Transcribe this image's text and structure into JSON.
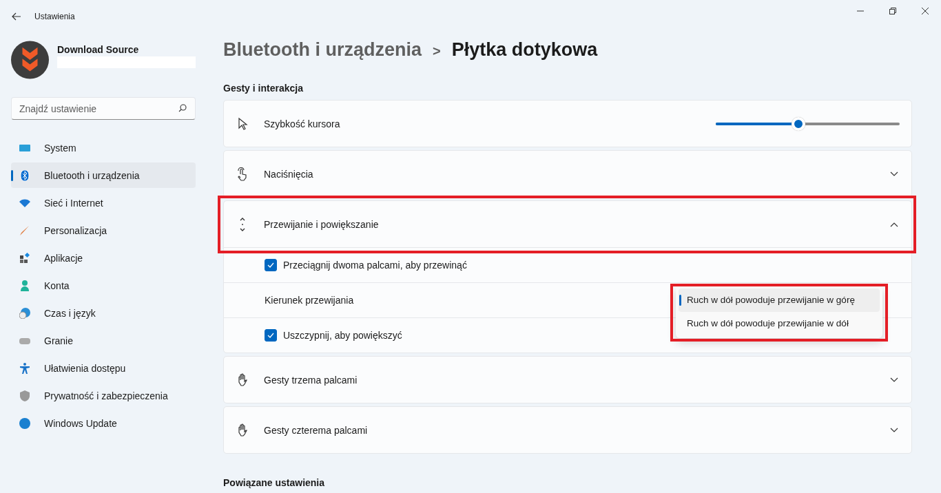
{
  "window": {
    "title": "Ustawienia"
  },
  "profile": {
    "name": "Download Source"
  },
  "search": {
    "placeholder": "Znajdź ustawienie"
  },
  "nav": [
    {
      "label": "System",
      "selected": false
    },
    {
      "label": "Bluetooth i urządzenia",
      "selected": true
    },
    {
      "label": "Sieć i Internet",
      "selected": false
    },
    {
      "label": "Personalizacja",
      "selected": false
    },
    {
      "label": "Aplikacje",
      "selected": false
    },
    {
      "label": "Konta",
      "selected": false
    },
    {
      "label": "Czas i język",
      "selected": false
    },
    {
      "label": "Granie",
      "selected": false
    },
    {
      "label": "Ułatwienia dostępu",
      "selected": false
    },
    {
      "label": "Prywatność i zabezpieczenia",
      "selected": false
    },
    {
      "label": "Windows Update",
      "selected": false
    }
  ],
  "breadcrumb": {
    "parent": "Bluetooth i urządzenia",
    "separator": ">",
    "current": "Płytka dotykowa"
  },
  "section_title": "Gesty i interakcja",
  "settings": [
    {
      "kind": "slider",
      "label": "Szybkość kursora",
      "level": 0.45
    },
    {
      "kind": "expander",
      "label": "Naciśnięcia",
      "expanded": false
    },
    {
      "kind": "expander",
      "label": "Przewijanie i powiększanie",
      "expanded": true,
      "highlighted": true,
      "children": [
        {
          "kind": "checkbox",
          "label": "Przeciągnij dwoma palcami, aby przewinąć",
          "checked": true
        },
        {
          "kind": "dropdown",
          "label": "Kierunek przewijania",
          "options": [
            {
              "label": "Ruch w dół powoduje przewijanie w górę",
              "selected": true
            },
            {
              "label": "Ruch w dół powoduje przewijanie w dół",
              "selected": false
            }
          ]
        },
        {
          "kind": "checkbox",
          "label": "Uszczypnij, aby powiększyć",
          "checked": true
        }
      ]
    },
    {
      "kind": "expander",
      "label": "Gesty trzema palcami",
      "expanded": false
    },
    {
      "kind": "expander",
      "label": "Gesty czterema palcami",
      "expanded": false
    }
  ],
  "related_title": "Powiązane ustawienia"
}
